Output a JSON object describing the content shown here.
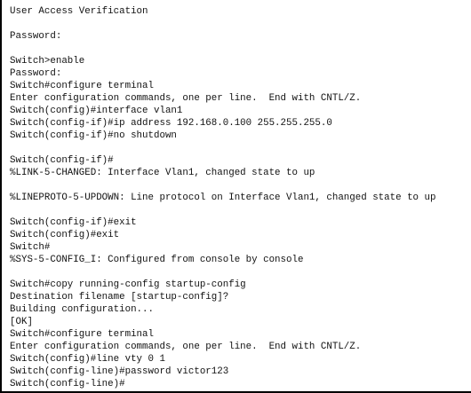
{
  "terminal": {
    "lines": [
      "User Access Verification",
      "",
      "Password:",
      "",
      "Switch>enable",
      "Password:",
      "Switch#configure terminal",
      "Enter configuration commands, one per line.  End with CNTL/Z.",
      "Switch(config)#interface vlan1",
      "Switch(config-if)#ip address 192.168.0.100 255.255.255.0",
      "Switch(config-if)#no shutdown",
      "",
      "Switch(config-if)#",
      "%LINK-5-CHANGED: Interface Vlan1, changed state to up",
      "",
      "%LINEPROTO-5-UPDOWN: Line protocol on Interface Vlan1, changed state to up",
      "",
      "Switch(config-if)#exit",
      "Switch(config)#exit",
      "Switch#",
      "%SYS-5-CONFIG_I: Configured from console by console",
      "",
      "Switch#copy running-config startup-config",
      "Destination filename [startup-config]?",
      "Building configuration...",
      "[OK]",
      "Switch#configure terminal",
      "Enter configuration commands, one per line.  End with CNTL/Z.",
      "Switch(config)#line vty 0 1",
      "Switch(config-line)#password victor123",
      "Switch(config-line)#"
    ]
  }
}
